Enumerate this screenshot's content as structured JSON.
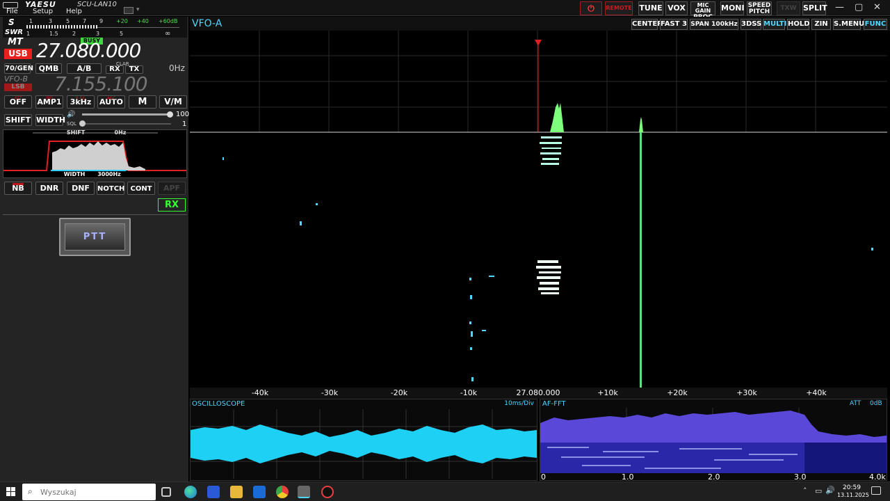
{
  "titlebar": {
    "brand": "YAESU",
    "model": "SCU-LAN10",
    "menu": [
      "File",
      "Setup",
      "Help"
    ],
    "buttons": {
      "power_icon": "power-icon",
      "remote": "REMOTE",
      "tune": "TUNE",
      "vox": "VOX",
      "mic_gain_top": "MIC GAIN",
      "mic_gain_bottom": "PROC",
      "moni": "MONI",
      "speed_top": "SPEED",
      "speed_bottom": "PITCH",
      "txw": "TXW",
      "split": "SPLIT"
    },
    "window_controls": [
      "—",
      "▢",
      "✕"
    ]
  },
  "meter": {
    "s_label": "S",
    "swr_label": "SWR",
    "s_scale": [
      "1",
      "3",
      "5",
      "7",
      "9",
      "+20",
      "+40",
      "+60dB"
    ],
    "swr_scale": [
      "1",
      "1.5",
      "2",
      "3",
      "5",
      "∞"
    ]
  },
  "vfo_a": {
    "mode_top": "MT",
    "mode": "USB",
    "busy": "BUSY",
    "freq": "27.080.000"
  },
  "row_buttons": {
    "gen": "70/GEN",
    "qmb": "QMB",
    "ab": "A/B",
    "clar": "CLAR",
    "rx": "RX",
    "tx": "TX",
    "hz": "0Hz"
  },
  "vfo_b": {
    "label": "VFO-B",
    "mode": "LSB",
    "freq": "7.155.100"
  },
  "controls": {
    "att": {
      "top": "ATT",
      "bottom": "OFF"
    },
    "ipo": {
      "top": "IPO",
      "bottom": "AMP1"
    },
    "roof": {
      "top": "R.FIL",
      "bottom": "3kHz"
    },
    "agc": {
      "top": "AGC",
      "bottom": "AUTO"
    },
    "m": "M",
    "vm": "V/M",
    "shift": "SHIFT",
    "width": "WIDTH",
    "vol_value": "100",
    "sql_label": "SQL",
    "sql_value": "1"
  },
  "filter_display": {
    "shift_label": "SHIFT",
    "shift_value": "0Hz",
    "width_label": "WIDTH",
    "width_value": "3000Hz"
  },
  "dsp_buttons": [
    "NB",
    "DNR",
    "DNF",
    "NOTCH",
    "CONT",
    "APF"
  ],
  "status": {
    "rx": "RX",
    "ptt": "PTT"
  },
  "scope": {
    "vfo_label": "VFO-A",
    "header_buttons": [
      "CENTER",
      "FAST 3",
      "SPAN  100kHz",
      "3DSS",
      "MULTI",
      "HOLD",
      "ZIN",
      "S.MENU",
      "FUNC"
    ],
    "axis_ticks": [
      "-40k",
      "-30k",
      "-20k",
      "-10k",
      "27.080.000",
      "+10k",
      "+20k",
      "+30k",
      "+40k"
    ]
  },
  "oscilloscope": {
    "title": "OSCILLOSCOPE",
    "scale": "10ms/Div"
  },
  "affft": {
    "title": "AF-FFT",
    "att": "ATT",
    "att_value": "0dB",
    "ticks": [
      "0",
      "1.0",
      "2.0",
      "3.0",
      "4.0k"
    ]
  },
  "taskbar": {
    "search_placeholder": "Wyszukaj",
    "time": "20:59",
    "date": "13.11.2025"
  },
  "colors": {
    "accent_cyan": "#4fd8ff",
    "signal_green": "#7dff7d",
    "red_label": "#e82020"
  }
}
